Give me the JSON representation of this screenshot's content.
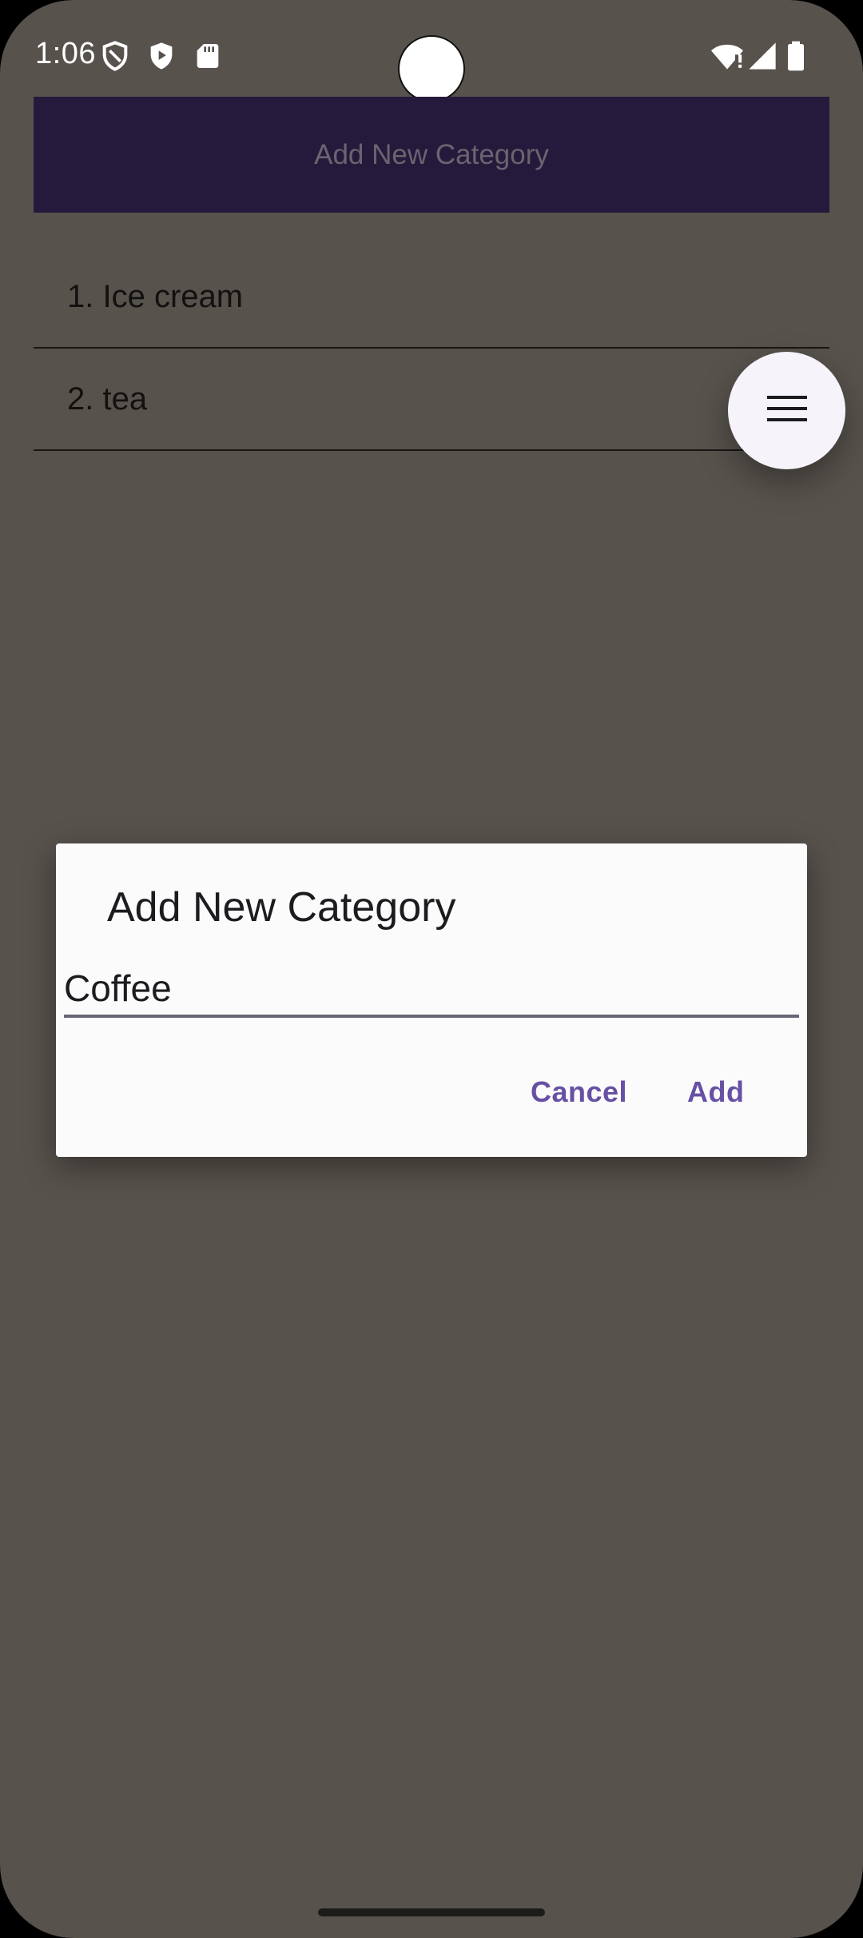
{
  "status_bar": {
    "time": "1:06",
    "left_icons": [
      "shield-outline-icon",
      "shield-play-icon",
      "sd-card-icon"
    ],
    "right_icons": [
      "wifi-alert-icon",
      "signal-icon",
      "battery-icon"
    ]
  },
  "app_bar": {
    "title": "Add New Category"
  },
  "categories": [
    {
      "label": "1. Ice cream"
    },
    {
      "label": "2. tea"
    }
  ],
  "fab": {
    "icon": "menu-icon"
  },
  "dialog": {
    "title": "Add New Category",
    "input_value": "Coffee",
    "cancel_label": "Cancel",
    "add_label": "Add"
  },
  "colors": {
    "scrim_background": "#57524c",
    "app_bar": "#241b3c",
    "accent": "#6750a4",
    "dialog_background": "#fbfbfb"
  }
}
